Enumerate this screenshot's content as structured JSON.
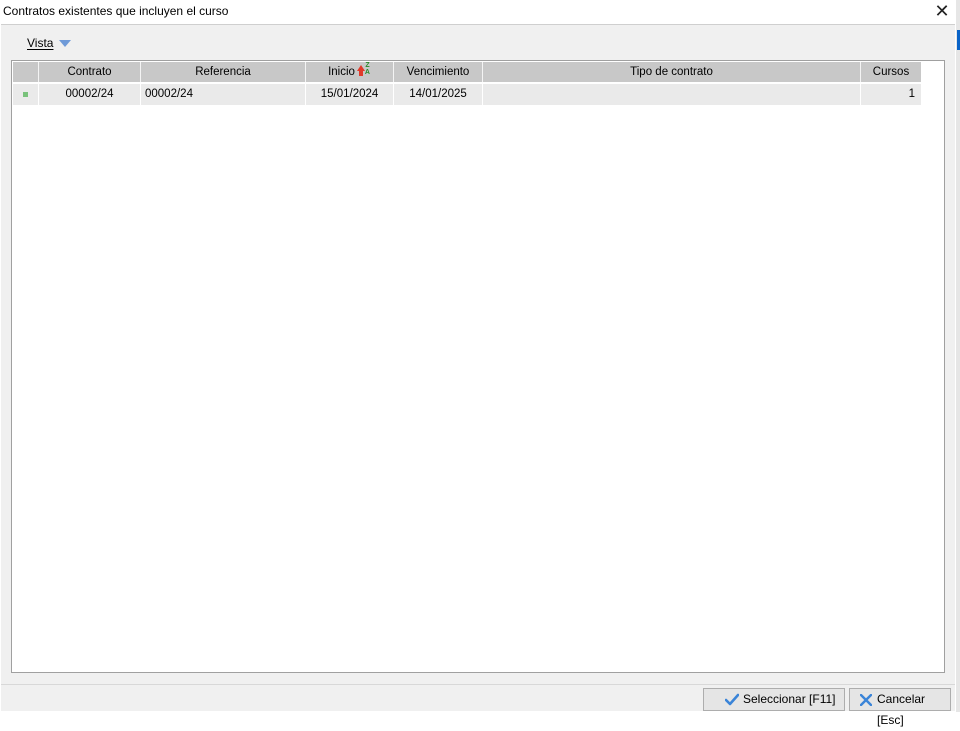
{
  "window": {
    "title": "Contratos existentes que incluyen el curso",
    "close_glyph": "✕"
  },
  "toolbar": {
    "vista_label": "Vista"
  },
  "table": {
    "columns": [
      "",
      "Contrato",
      "Referencia",
      "Inicio",
      "Vencimiento",
      "Tipo de contrato",
      "Cursos"
    ],
    "sorted_column": "Inicio",
    "rows": [
      {
        "contrato": "00002/24",
        "referencia": "00002/24",
        "inicio": "15/01/2024",
        "vencimiento": "14/01/2025",
        "tipo": "",
        "cursos": "1"
      }
    ]
  },
  "buttons": {
    "select_label": "Seleccionar [F11]",
    "cancel_label": "Cancelar [Esc]"
  },
  "colors": {
    "header_bg": "#c8c8c8",
    "row_bg": "#eaeaea",
    "marker": "#79c27b",
    "check": "#3a84d8"
  },
  "icons": {
    "sort": "sort-desc-icon",
    "select": "checkmark-icon",
    "cancel": "x-cross-icon"
  }
}
